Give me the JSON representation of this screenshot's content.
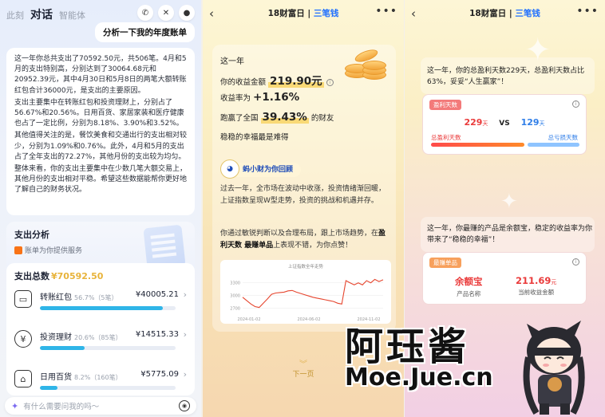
{
  "panel1": {
    "tabs": [
      "此刻",
      "对话",
      "智能体"
    ],
    "active_tab": 1,
    "icons": [
      "phone-icon",
      "mute-icon",
      "user-icon"
    ],
    "user_message": "分析一下我的年度账单",
    "answer_paragraphs": [
      "这一年你总共支出了70592.50元，共506笔。4月和5月的支出特别高，分别达到了30064.68元和20952.39元，其中4月30日和5月8日的两笔大额转账红包合计36000元，是支出的主要原因。",
      "支出主要集中在转账红包和投资理财上，分别占了56.67%和20.56%。日用百货、家居家装和医疗健康也占了一定比例，分别为8.18%、3.90%和3.52%。",
      "其他值得关注的是，餐饮美食和交通出行的支出相对较少，分别为1.09%和0.76%。此外，4月和5月的支出占了全年支出的72.27%，其他月份的支出较为均匀。",
      "整体来看，你的支出主要集中在少数几笔大额交易上，其他月份的支出相对平稳。希望这些数据能帮你更好地了解自己的财务状况。"
    ],
    "analysis_title": "支出分析",
    "analysis_sub": "账单为你提供服务",
    "total_label": "支出总数",
    "total_value": "¥70592.50",
    "categories": [
      {
        "name": "转账红包",
        "pct": "56.7%",
        "count": "（5笔）",
        "amount": "¥40005.21",
        "icon": "wallet-icon",
        "glyph": "▭",
        "share": 56.7
      },
      {
        "name": "投资理财",
        "pct": "20.6%",
        "count": "（85笔）",
        "amount": "¥14515.33",
        "icon": "yen-icon",
        "glyph": "¥",
        "share": 20.6
      },
      {
        "name": "日用百货",
        "pct": "8.2%",
        "count": "（160笔）",
        "amount": "¥5775.09",
        "icon": "shop-icon",
        "glyph": "⌂",
        "share": 8.2
      }
    ],
    "input_placeholder": "有什么需要问我的吗～",
    "accent": "#2fb5e8"
  },
  "header": {
    "logo_left": "18财富日",
    "logo_right": "三笔钱",
    "more": "•••"
  },
  "panel2": {
    "year_line": "这一年",
    "income_label": "你的收益金额",
    "income_value": "219.90元",
    "rate_label": "收益率为",
    "rate_value": "+1.16%",
    "beat_pre": "跑赢了全国",
    "beat_value": "39.43%",
    "beat_post": "的财友",
    "luck_line": "稳稳的幸福最是难得",
    "ant_label": "蚂小财为你回顾",
    "para1": "过去一年，全市场在波动中收涨，投资情绪渐回暖，上证指数呈现W型走势，投资的挑战和机遇并存。",
    "para2_pre": "你通过敏锐判断以及合理布局，跟上市场趋势，在",
    "para2_bold": "盈利天数 最赚单品",
    "para2_post": "上表现不错，为你点赞！",
    "next_page": "下一页"
  },
  "chart_data": {
    "type": "line",
    "title": "上证指数全年走势",
    "yticks": [
      "3300",
      "3000",
      "2700"
    ],
    "xticks": [
      "2024-01-02",
      "2024-06-02",
      "2024-11-02"
    ],
    "ylim": [
      2600,
      3500
    ],
    "values": [
      2960,
      2880,
      2800,
      2740,
      2720,
      2820,
      2920,
      3030,
      3060,
      3070,
      3080,
      3110,
      3120,
      3080,
      3050,
      3020,
      2990,
      2960,
      2940,
      2920,
      2900,
      2880,
      2860,
      2820,
      2800,
      3350,
      3300,
      3250,
      3300,
      3250,
      3350,
      3300,
      3380,
      3330,
      3370
    ],
    "grid": true
  },
  "panel3": {
    "intro": "这一年，你的总盈利天数229天，总盈利天数占比63%，妥妥“人生赢家”！",
    "card_tag": "盈利天数",
    "profit_days": "229",
    "total_days": "129",
    "day_unit": "天",
    "vs": "VS",
    "profit_label": "总盈利天数",
    "total_label": "总亏损天数",
    "profit_share": 63,
    "para2": "这一年，你最赚的产品是余额宝，稳定的收益率为你带来了“稳稳的幸福”！",
    "product_tag": "最赚单品",
    "product_name": "余额宝",
    "product_name_label": "产品名称",
    "product_income": "211.69",
    "product_unit": "元",
    "product_income_label": "当前收益金额"
  },
  "watermark": {
    "title": "阿珏酱",
    "url": "Moe.Jue.cn"
  }
}
